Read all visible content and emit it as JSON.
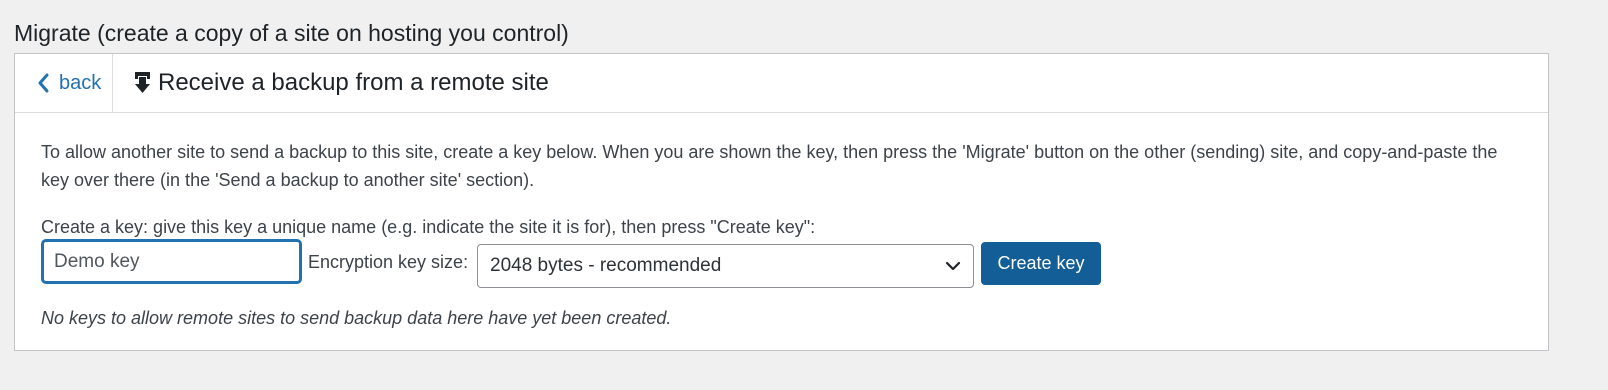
{
  "page": {
    "title": "Migrate (create a copy of a site on hosting you control)"
  },
  "panel": {
    "back_label": "back",
    "back_icon": "chevron-left-icon",
    "title_icon": "download-icon",
    "title": "Receive a backup from a remote site",
    "intro": "To allow another site to send a backup to this site, create a key below. When you are shown the key, then press the 'Migrate' button on the other (sending) site, and copy-and-paste the key over there (in the 'Send a backup to another site' section).",
    "create_label": "Create a key: give this key a unique name (e.g. indicate the site it is for), then press \"Create key\":",
    "key_name_value": "Demo key",
    "size_label": "Encryption key size:",
    "size_selected": "2048 bytes - recommended",
    "create_button": "Create key",
    "no_keys_message": "No keys to allow remote sites to send backup data here have yet been created."
  },
  "colors": {
    "accent": "#2271b1",
    "button": "#135e96",
    "background": "#f0f0f1"
  }
}
